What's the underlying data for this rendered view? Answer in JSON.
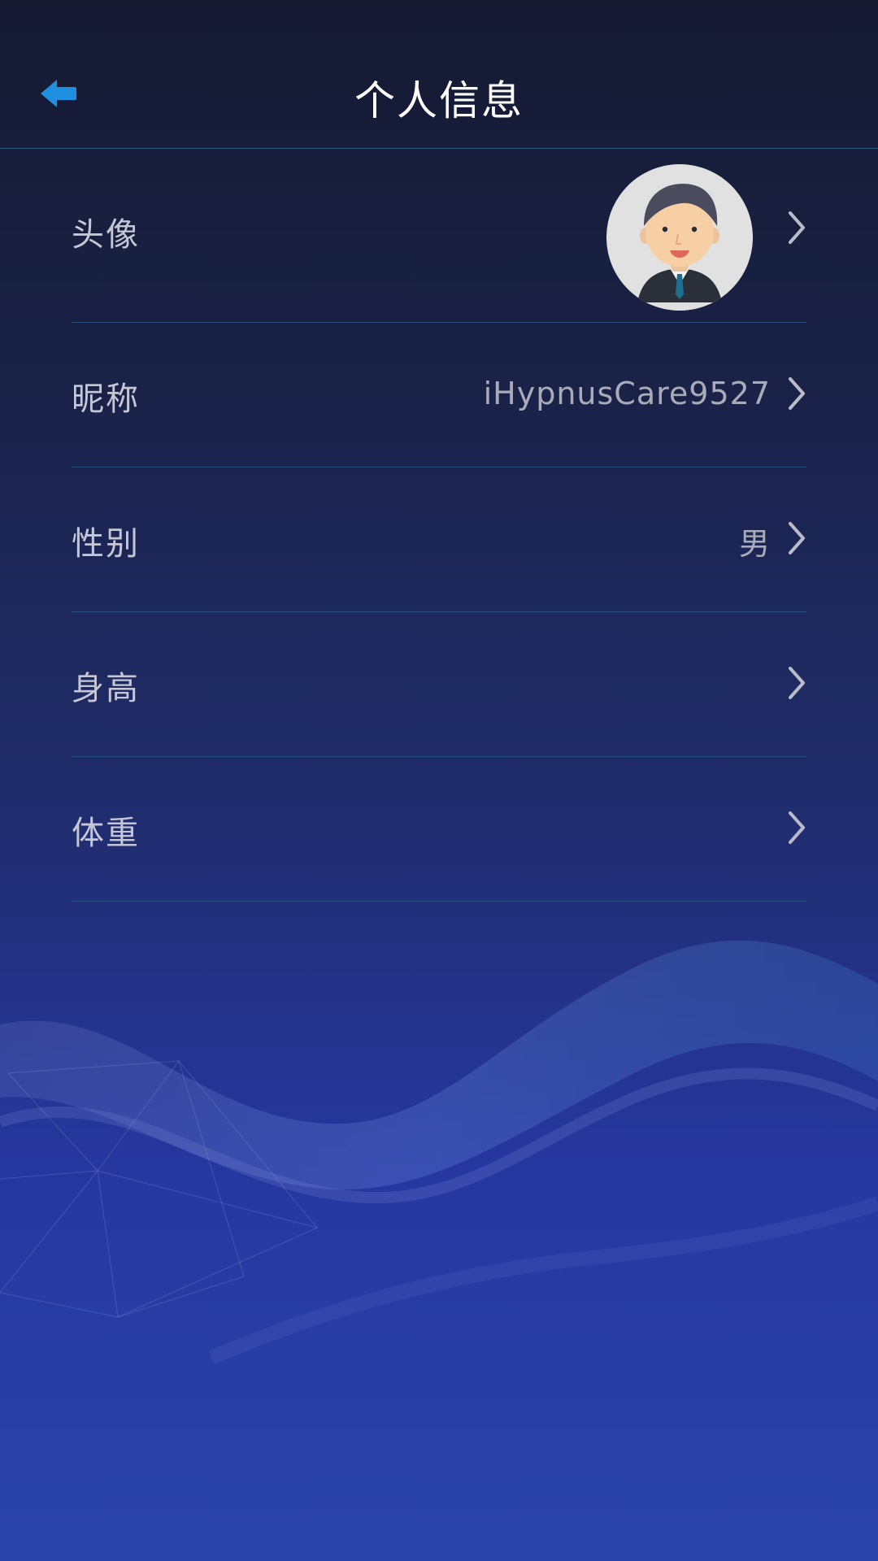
{
  "header": {
    "title": "个人信息",
    "back_icon": "back-arrow-icon"
  },
  "profile": {
    "avatar": {
      "label": "头像",
      "icon": "avatar-icon"
    },
    "nickname": {
      "label": "昵称",
      "value": "iHypnusCare9527"
    },
    "gender": {
      "label": "性别",
      "value": "男"
    },
    "height": {
      "label": "身高",
      "value": ""
    },
    "weight": {
      "label": "体重",
      "value": ""
    }
  },
  "colors": {
    "accent": "#1f8fe0",
    "title_text": "#ffffff",
    "label_text": "#c5c7d4",
    "value_text": "#a9acb8",
    "divider": "#23507a"
  }
}
